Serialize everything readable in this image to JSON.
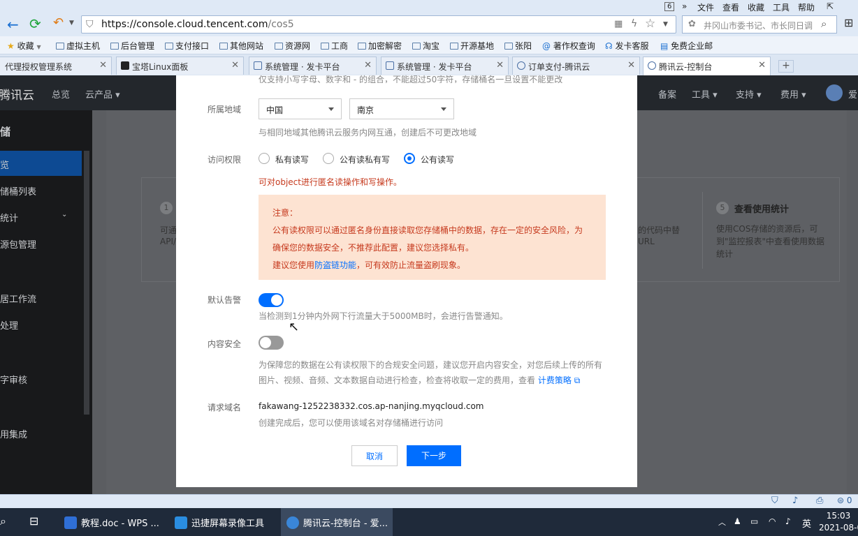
{
  "browser": {
    "menu": [
      "文件",
      "查看",
      "收藏",
      "工具",
      "帮助"
    ],
    "tab_count": "6",
    "address": {
      "host": "https://console.cloud.tencent.com",
      "path": "/cos5"
    },
    "search_placeholder": "井冈山市委书记、市长同日调",
    "bookmarks": [
      "收藏",
      "虚拟主机",
      "后台管理",
      "支付接口",
      "其他网站",
      "资源网",
      "工商",
      "加密解密",
      "淘宝",
      "开源基地",
      "张阳",
      "著作权查询",
      "发卡客服",
      "免费企业邮"
    ],
    "tabs": [
      "代理授权管理系统",
      "宝塔Linux面板",
      "系统管理 · 发卡平台",
      "系统管理 · 发卡平台",
      "订单支付-腾讯云",
      "腾讯云-控制台"
    ]
  },
  "console": {
    "brand": "腾讯云",
    "topnav": [
      "总览",
      "云产品",
      "备案",
      "工具",
      "支持",
      "费用",
      "爱"
    ],
    "sidebar_title": "储",
    "sidebar_items": [
      "览",
      "储桶列表",
      "统计",
      "源包管理",
      "居工作流",
      "处理",
      "字审核",
      "用集成"
    ],
    "bg_card": {
      "step_num": "5",
      "title": "查看使用统计",
      "desc": "使用COS存储的资源后，可到\"监控报表\"中查看使用数据统计",
      "left_num": "1",
      "left_text1": "可通",
      "left_text2": "API/",
      "mid_text1": "的代码中替",
      "mid_text2": "URL"
    }
  },
  "modal": {
    "top_hint": "仅支持小写字母、数字和 - 的组合，不能超过50字符，存储桶名一旦设置不能更改",
    "region": {
      "label": "所属地域",
      "country": "中国",
      "city": "南京",
      "hint": "与相同地域其他腾讯云服务内网互通，创建后不可更改地域"
    },
    "access": {
      "label": "访问权限",
      "options": [
        "私有读写",
        "公有读私有写",
        "公有读写"
      ],
      "selected": "公有读写",
      "warning": "可对object进行匿名读操作和写操作。"
    },
    "notice": {
      "title": "注意：",
      "line1": "公有读权限可以通过匿名身份直接读取您存储桶中的数据，存在一定的安全风险，为",
      "line2": "确保您的数据安全，不推荐此配置，建议您选择私有。",
      "line3_pre": "建议您使用",
      "line3_link": "防盗链功能",
      "line3_post": "，可有效防止流量盗刷现象。"
    },
    "alarm": {
      "label": "默认告警",
      "enabled": true,
      "hint": "当检测到1分钟内外网下行流量大于5000MB时，会进行告警通知。"
    },
    "content_security": {
      "label": "内容安全",
      "enabled": false,
      "hint1": "为保障您的数据在公有读权限下的合规安全问题，建议您开启内容安全，对您后续上传的所有",
      "hint2": "图片、视频、音频、文本数据自动进行检查，检查将收取一定的费用，查看",
      "link": "计费策略"
    },
    "domain": {
      "label": "请求域名",
      "value": "fakawang-1252238332.cos.ap-nanjing.myqcloud.com",
      "hint": "创建完成后，您可以使用该域名对存储桶进行访问"
    },
    "cancel_label": "取消",
    "next_label": "下一步"
  },
  "taskbar": {
    "items": [
      "教程.doc - WPS ...",
      "迅捷屏幕录像工具",
      "腾讯云-控制台 - 爱..."
    ],
    "ime": "英",
    "time": "15:03",
    "date": "2021-08-0",
    "status_count": "0"
  },
  "colors": {
    "primary": "#006eff",
    "warning": "#c63a1e",
    "notice_bg": "#fde3d2"
  }
}
